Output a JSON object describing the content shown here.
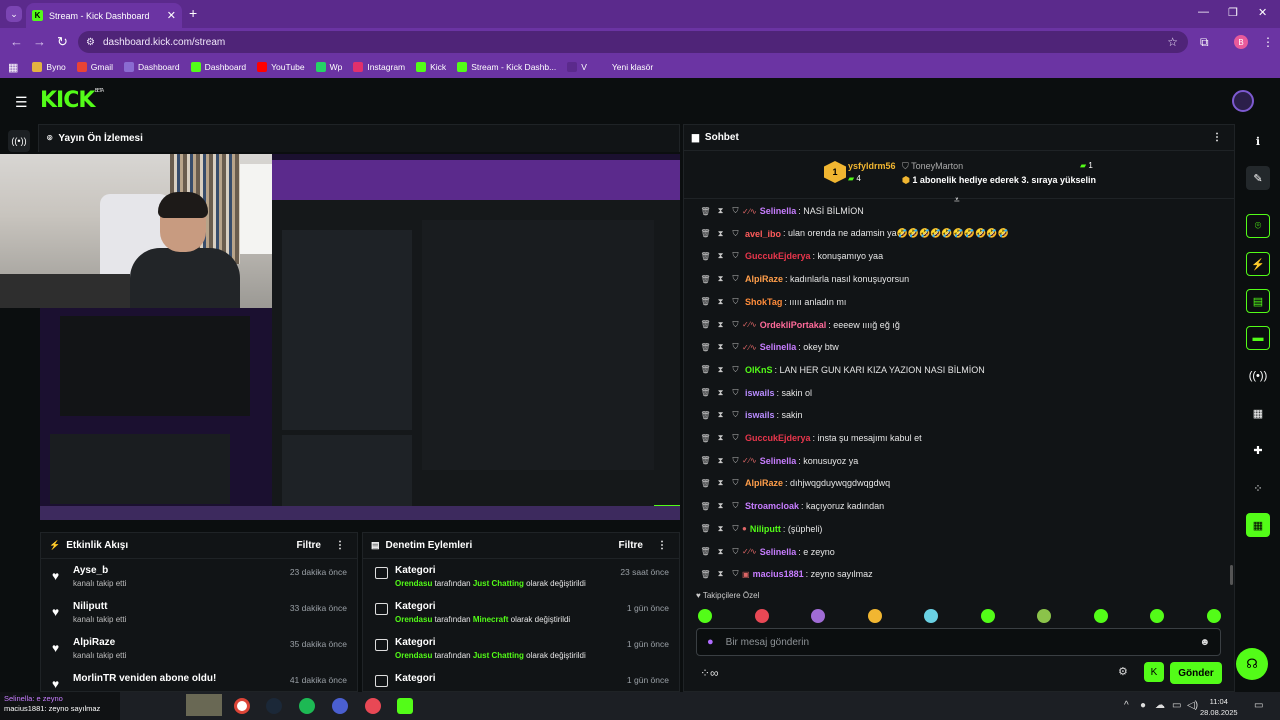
{
  "browser": {
    "tab_title": "Stream - Kick Dashboard",
    "tab_close": "✕",
    "new_tab": "+",
    "url": "dashboard.kick.com/stream",
    "profile_initial": "B",
    "window_controls": {
      "minimize": "—",
      "restore": "❐",
      "close": "✕"
    },
    "bookmarks": [
      {
        "label": "Byno",
        "color": "#e3b341"
      },
      {
        "label": "Gmail",
        "color": "#ea4335"
      },
      {
        "label": "Dashboard",
        "color": "#8a6bd1"
      },
      {
        "label": "Dashboard",
        "color": "#53fc18"
      },
      {
        "label": "YouTube",
        "color": "#ff0000"
      },
      {
        "label": "Wp",
        "color": "#25d366"
      },
      {
        "label": "Instagram",
        "color": "#e1306c"
      },
      {
        "label": "Kick",
        "color": "#53fc18"
      },
      {
        "label": "Stream - Kick Dashb...",
        "color": "#53fc18"
      },
      {
        "label": "V",
        "color": "#5b2a8c"
      },
      {
        "label": "Yeni klasör",
        "color": "#6b34a3"
      }
    ]
  },
  "kick": {
    "logo": "KICK",
    "logo_beta": "BETA"
  },
  "preview": {
    "title": "Yayın Ön İzlemesi"
  },
  "activity": {
    "title": "Etkinlik Akışı",
    "filter": "Filtre",
    "items": [
      {
        "name": "Ayse_b",
        "desc": "kanalı takip etti",
        "time": "23 dakika önce"
      },
      {
        "name": "Niliputt",
        "desc": "kanalı takip etti",
        "time": "33 dakika önce"
      },
      {
        "name": "AlpiRaze",
        "desc": "kanalı takip etti",
        "time": "35 dakika önce"
      },
      {
        "name": "MorlinTR veniden abone oldu!",
        "desc": "",
        "time": "41 dakika önce"
      }
    ]
  },
  "moderation": {
    "title": "Denetim Eylemleri",
    "filter": "Filtre",
    "items": [
      {
        "title": "Kategori",
        "user": "Orendasu",
        "mid": " tarafından ",
        "cat": "Just Chatting",
        "end": " olarak değiştirildi",
        "time": "23 saat önce"
      },
      {
        "title": "Kategori",
        "user": "Orendasu",
        "mid": " tarafından ",
        "cat": "Minecraft",
        "end": " olarak değiştirildi",
        "time": "1 gün önce"
      },
      {
        "title": "Kategori",
        "user": "Orendasu",
        "mid": " tarafından ",
        "cat": "Just Chatting",
        "end": " olarak değiştirildi",
        "time": "1 gün önce"
      },
      {
        "title": "Kategori",
        "user": "",
        "mid": "",
        "cat": "",
        "end": "",
        "time": "1 gün önce"
      }
    ]
  },
  "chat": {
    "title": "Sohbet",
    "pinned": {
      "rank": "1",
      "gifter": "ysfyldrm56",
      "gifter_count": "4",
      "recipient": "ToneyMarton",
      "recipient_count": "1",
      "message": "1 abonelik hediye ederek 3. sıraya yükselin"
    },
    "messages": [
      {
        "user": "Selinella",
        "color": "#c77dff",
        "badge": "✓∕∿",
        "text": ": NASİ BİLMİON"
      },
      {
        "user": "avel_ibo",
        "color": "#ff5b5b",
        "badge": "",
        "text": ": ulan orenda ne adamsin ya🤣🤣🤣🤣🤣🤣🤣🤣🤣🤣"
      },
      {
        "user": "GuccukEjderya",
        "color": "#e8364c",
        "badge": "",
        "text": ": konuşamıyo yaa"
      },
      {
        "user": "AlpiRaze",
        "color": "#ff9e4a",
        "badge": "",
        "text": ": kadınlarla nasıl konuşuyorsun"
      },
      {
        "user": "ShokTag",
        "color": "#ff8c3a",
        "badge": "",
        "text": ": ııııı anladın mı"
      },
      {
        "user": "OrdekliPortakal",
        "color": "#ff6b9a",
        "badge": "✓∕∿",
        "text": ": eeeew ıııığ eğ ığ"
      },
      {
        "user": "Selinella",
        "color": "#c77dff",
        "badge": "✓∕∿",
        "text": ": okey btw"
      },
      {
        "user": "OlKnS",
        "color": "#53fc18",
        "badge": "",
        "text": ": LAN HER GUN KARI KIZA YAZION NASI BİLMİON"
      },
      {
        "user": "iswails",
        "color": "#b98cff",
        "badge": "",
        "text": ": sakin ol"
      },
      {
        "user": "iswails",
        "color": "#b98cff",
        "badge": "",
        "text": ": sakin"
      },
      {
        "user": "GuccukEjderya",
        "color": "#e8364c",
        "badge": "",
        "text": ": insta şu mesajımı kabul et"
      },
      {
        "user": "Selinella",
        "color": "#c77dff",
        "badge": "✓∕∿",
        "text": ": konusuyoz ya"
      },
      {
        "user": "AlpiRaze",
        "color": "#ff9e4a",
        "badge": "",
        "text": ": dıhjwqgduywqgdwqgdwq"
      },
      {
        "user": "Stroamcloak",
        "color": "#c77dff",
        "badge": "",
        "text": ": kaçıyoruz kadından"
      },
      {
        "user": "Niliputt",
        "color": "#53fc18",
        "badge": "●",
        "text": ": (şüpheli)"
      },
      {
        "user": "Selinella",
        "color": "#c77dff",
        "badge": "✓∕∿",
        "text": ": e zeyno"
      },
      {
        "user": "macius1881",
        "color": "#c77dff",
        "badge": "▣",
        "text": ": zeyno sayılmaz"
      }
    ],
    "follower_only": "Takipçilere Özel",
    "input_placeholder": "Bir mesaj gönderin",
    "send": "Gönder"
  },
  "taskbar": {
    "time": "11:04",
    "date": "28.08.2025",
    "notif_line1": "Selinella: e zeyno",
    "notif_line2": "macius1881: zeyno sayılmaz"
  }
}
